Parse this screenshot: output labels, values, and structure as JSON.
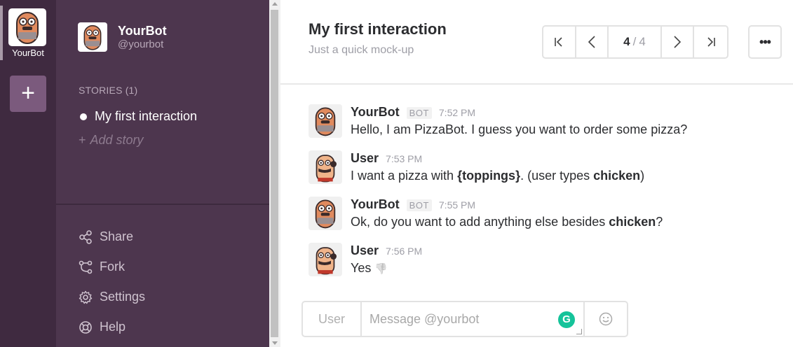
{
  "rail": {
    "bot_name": "YourBot",
    "add_label": "+"
  },
  "sidebar": {
    "bot_title": "YourBot",
    "bot_handle": "@yourbot",
    "stories_heading": "STORIES (1)",
    "stories": [
      {
        "label": "My first interaction",
        "active": true
      }
    ],
    "add_story": "Add story",
    "menu": [
      {
        "label": "Share",
        "icon": "share-icon"
      },
      {
        "label": "Fork",
        "icon": "fork-icon"
      },
      {
        "label": "Settings",
        "icon": "gear-icon"
      },
      {
        "label": "Help",
        "icon": "lifebuoy-icon"
      }
    ]
  },
  "header": {
    "title": "My first interaction",
    "subtitle": "Just a quick mock-up",
    "pager": {
      "current": "4",
      "separator": "/",
      "total": "4"
    },
    "more_label": "•••"
  },
  "messages": [
    {
      "author": "YourBot",
      "is_bot": true,
      "bot_badge": "BOT",
      "time": "7:52 PM",
      "text": "Hello, I am PizzaBot. I guess you want to order some pizza?"
    },
    {
      "author": "User",
      "is_bot": false,
      "time": "7:53 PM",
      "parts": [
        "I want a pizza with ",
        "{toppings}",
        ". (user types ",
        "chicken",
        ")"
      ]
    },
    {
      "author": "YourBot",
      "is_bot": true,
      "bot_badge": "BOT",
      "time": "7:55 PM",
      "parts": [
        "Ok, do you want to add anything else besides ",
        "chicken",
        "?"
      ]
    },
    {
      "author": "User",
      "is_bot": false,
      "time": "7:56 PM",
      "text": "Yes",
      "emoji": "👎"
    }
  ],
  "composer": {
    "sender": "User",
    "placeholder": "Message @yourbot",
    "grammarly": "G"
  },
  "colors": {
    "rail": "#3f2a40",
    "sidebar": "#4d364e",
    "grammarly": "#15c39a"
  }
}
